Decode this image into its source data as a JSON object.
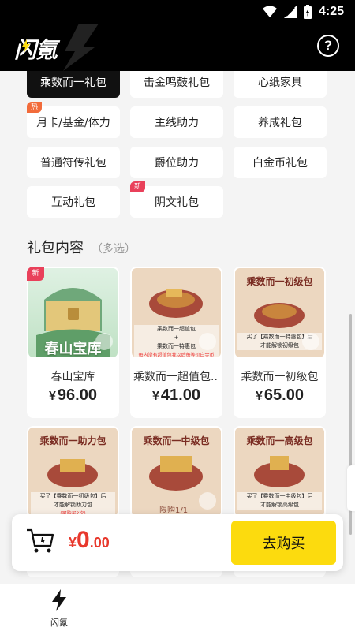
{
  "status_bar": {
    "time": "4:25"
  },
  "header": {
    "logo_text": "闪氪",
    "help_label": "?"
  },
  "categories": [
    {
      "label": "乘数而一礼包",
      "active": true
    },
    {
      "label": "击金鸣鼓礼包"
    },
    {
      "label": "心纸家具"
    },
    {
      "label": "月卡/基金/体力",
      "badge": "热"
    },
    {
      "label": "主线助力"
    },
    {
      "label": "养成礼包"
    },
    {
      "label": "普通符传礼包"
    },
    {
      "label": "爵位助力"
    },
    {
      "label": "白金币礼包"
    },
    {
      "label": "互动礼包"
    },
    {
      "label": "阴文礼包",
      "badge": "新"
    }
  ],
  "section": {
    "title": "礼包内容",
    "subtitle": "（多选）"
  },
  "products": [
    {
      "name": "春山宝库",
      "price": "96.00",
      "badge": "新",
      "image_caption": "春山宝库"
    },
    {
      "name": "乘数而一超值包...",
      "price": "41.00",
      "image_note_lines": [
        "乘数而一超值包",
        "+",
        "乘数而一特惠包"
      ],
      "image_note_red": "每内没有超值包我以后每等价白金币"
    },
    {
      "name": "乘数而一初级包",
      "price": "65.00",
      "image_title": "乘数而一初级包",
      "image_note_lines": [
        "买了【乘数而一特惠包】后",
        "才能解锁初级包"
      ]
    },
    {
      "name": "乘数而一助力包",
      "image_title": "乘数而一助力包",
      "image_note_lines": [
        "买了【乘数而一初级包】后",
        "才能解锁助力包"
      ],
      "image_note_red": "(可购买2次)"
    },
    {
      "name": "乘数而一中级包",
      "image_title": "乘数而一中级包",
      "image_limit": "限购1/1"
    },
    {
      "name": "乘数而一高级包",
      "image_title": "乘数而一高级包",
      "image_note_lines": [
        "买了【乘数而一中级包】后",
        "才能解锁高级包"
      ]
    }
  ],
  "checkout": {
    "currency": "¥",
    "amount_int": "0",
    "amount_dec": ".00",
    "buy_label": "去购买"
  },
  "nav": {
    "label": "闪氪"
  },
  "colors": {
    "accent_yellow": "#fcdb0e",
    "price_red": "#e8382c",
    "badge_red": "#e9405a",
    "badge_orange": "#f26b3a"
  }
}
